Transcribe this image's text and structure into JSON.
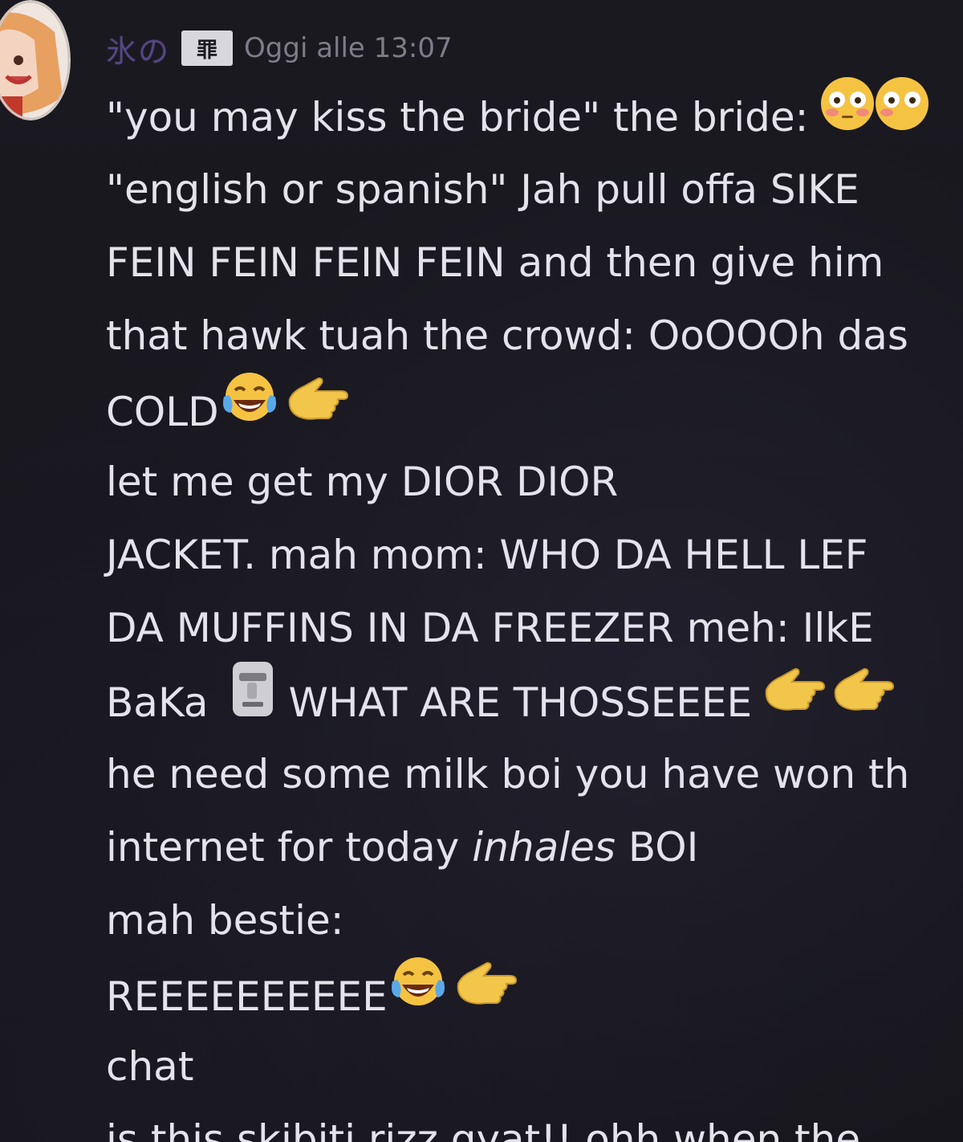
{
  "message": {
    "username": "氷の",
    "server_tag": "罪",
    "timestamp": "Oggi alle 13:07",
    "lines": [
      "\"you may kiss the bride\" the bride:",
      "\"english or spanish\" Jah pull offa SIKE",
      "FEIN FEIN FEIN FEIN and then give him",
      "that hawk tuah the crowd: OoOOOh das",
      "COLD",
      "let me get my DIOR DIOR",
      "JACKET. mah mom: WHO DA HELL LEF",
      "DA MUFFINS IN DA FREEZER meh: IlkE",
      "BaKa",
      "WHAT ARE THOSSEEEE",
      "he need some milk boi you have won th",
      "internet for today",
      "inhales",
      "BOI",
      "mah bestie:",
      "REEEEEEEEEE",
      "chat",
      "is this skibiti rizz gyat!! ohh when the"
    ]
  },
  "icons": {
    "flushed": "flushed-face-emoji",
    "laughing": "tears-of-joy-emoji",
    "pointing": "pointing-hand-emoji",
    "moai": "moai-emoji"
  },
  "colors": {
    "background": "#17161d",
    "text": "#e4e3ec",
    "timestamp": "#7e7c88",
    "username": "#5b4a8a"
  }
}
